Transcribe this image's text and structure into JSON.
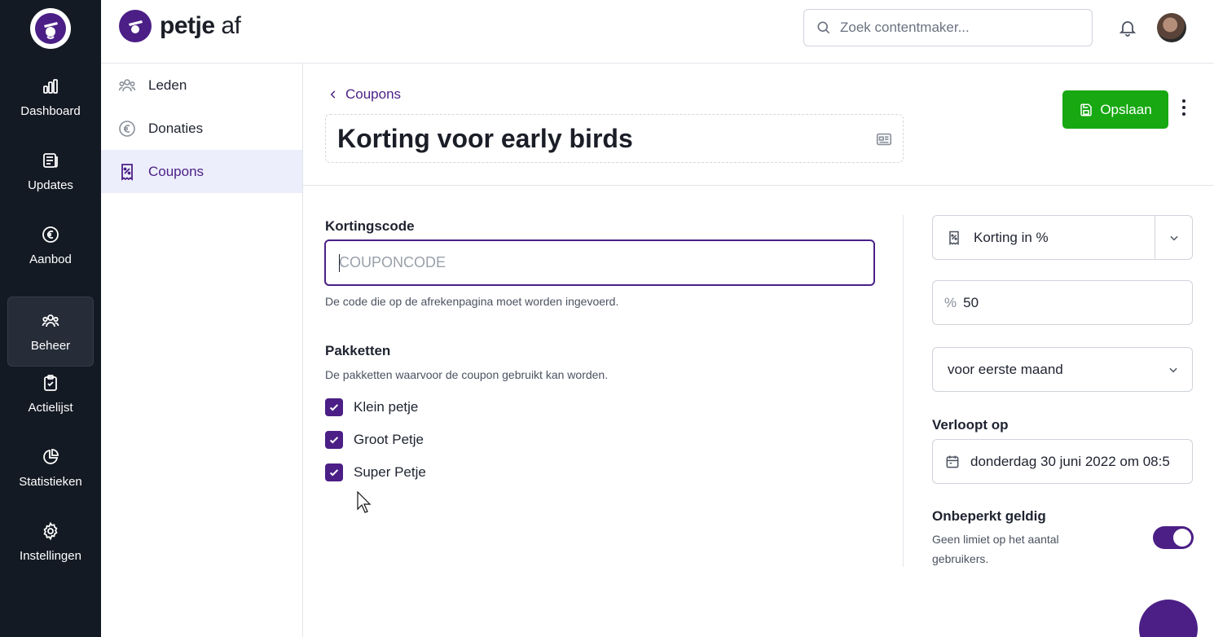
{
  "brand": {
    "name": "petje",
    "suffix": " af"
  },
  "rail": [
    {
      "label": "Dashboard",
      "icon": "bar-chart-icon"
    },
    {
      "label": "Updates",
      "icon": "newspaper-icon"
    },
    {
      "label": "Aanbod",
      "icon": "euro-icon"
    },
    {
      "label": "Beheer",
      "icon": "users-icon",
      "active": true
    },
    {
      "label": "Actielijst",
      "icon": "clipboard-check-icon"
    },
    {
      "label": "Statistieken",
      "icon": "pie-chart-icon"
    },
    {
      "label": "Instellingen",
      "icon": "gear-icon"
    }
  ],
  "search": {
    "placeholder": "Zoek contentmaker..."
  },
  "submenu": [
    {
      "label": "Leden",
      "icon": "users-icon"
    },
    {
      "label": "Donaties",
      "icon": "euro-icon"
    },
    {
      "label": "Coupons",
      "icon": "coupon-icon",
      "active": true
    }
  ],
  "page": {
    "back_label": "Coupons",
    "title": "Korting voor early birds",
    "save_label": "Opslaan"
  },
  "form": {
    "code_label": "Kortingscode",
    "code_placeholder": "COUPONCODE",
    "code_value": "",
    "code_help": "De code die op de afrekenpagina moet worden ingevoerd.",
    "packages_label": "Pakketten",
    "packages_help": "De pakketten waarvoor de coupon gebruikt kan worden.",
    "packages": [
      {
        "label": "Klein petje",
        "checked": true
      },
      {
        "label": "Groot Petje",
        "checked": true
      },
      {
        "label": "Super Petje",
        "checked": true
      }
    ]
  },
  "side": {
    "discount_type": "Korting in %",
    "percent_symbol": "%",
    "percent_value": "50",
    "duration": "voor eerste maand",
    "expires_label": "Verloopt op",
    "expires_value": "donderdag 30 juni 2022 om 08:5",
    "unlimited_label": "Onbeperkt geldig",
    "unlimited_help": "Geen limiet op het aantal gebruikers.",
    "unlimited_on": true
  },
  "colors": {
    "brand_purple": "#4b1f86",
    "save_green": "#17a812",
    "rail_bg": "#141a23"
  }
}
